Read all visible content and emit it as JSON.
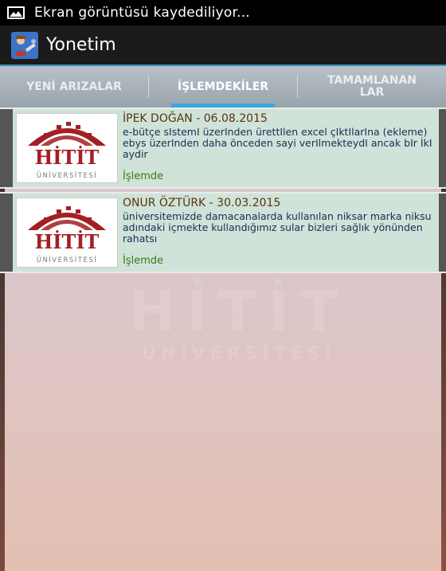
{
  "status_bar": {
    "text": "Ekran görüntüsü kaydediliyor..."
  },
  "action_bar": {
    "title": "Yonetim"
  },
  "tabs": [
    {
      "label": "YENİ ARIZALAR"
    },
    {
      "label": "İŞLEMDEKİLER"
    },
    {
      "label": "TAMAMLANANLAR"
    }
  ],
  "logo": {
    "name": "HİTİT",
    "sub": "ÜNİVERSİTESİ"
  },
  "items": [
    {
      "title": "İPEK DOĞAN - 06.08.2015",
      "description": "   e-bütçe sIstemI üzerInden ürettIlen excel çIktIlarIna (eklеme) ebys üzerInden daha önceden sayi verIlmekteydI ancak bIr İkI aydir",
      "status": "İşlemde"
    },
    {
      "title": "ONUR ÖZTÜRK - 30.03.2015",
      "description": "   üniversitemizde damacanalarda kullanılan niksar marka niksu adındaki içmekte kullandığımız sular bizleri sağlık yönünden rahatsı",
      "status": "İşlemde"
    }
  ],
  "colors": {
    "tab_indicator": "#39a7e0",
    "item_title": "#5a3410",
    "item_desc": "#1f2a57",
    "item_status": "#3c7a12",
    "logo_red": "#a31f24"
  }
}
